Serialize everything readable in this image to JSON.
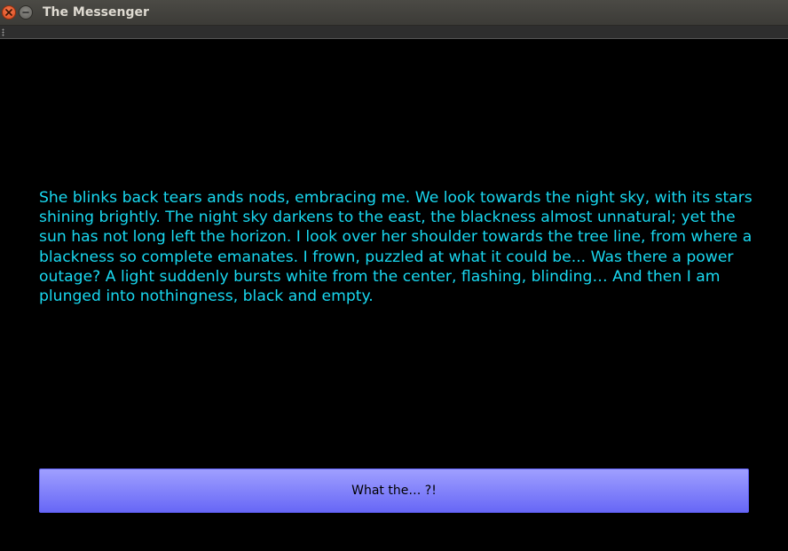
{
  "window": {
    "title": "The Messenger"
  },
  "story": {
    "text": "She blinks back tears ands nods, embracing me. We look towards the night sky, with its stars\nshining brightly. The night sky darkens to the east, the blackness almost unnatural;  yet the\nsun has not long left the horizon. I look over her shoulder towards the tree line, from where a\nblackness so complete emanates. I frown, puzzled at what it could be... Was there a power\noutage? A light suddenly bursts white from the center, flashing, blinding… And then I am\nplunged into nothingness, black and empty."
  },
  "action": {
    "label": "What the… ?!"
  },
  "colors": {
    "text": "#19d8f0",
    "background": "#000000",
    "button_top": "#9f9fff",
    "button_bottom": "#6767f6"
  }
}
